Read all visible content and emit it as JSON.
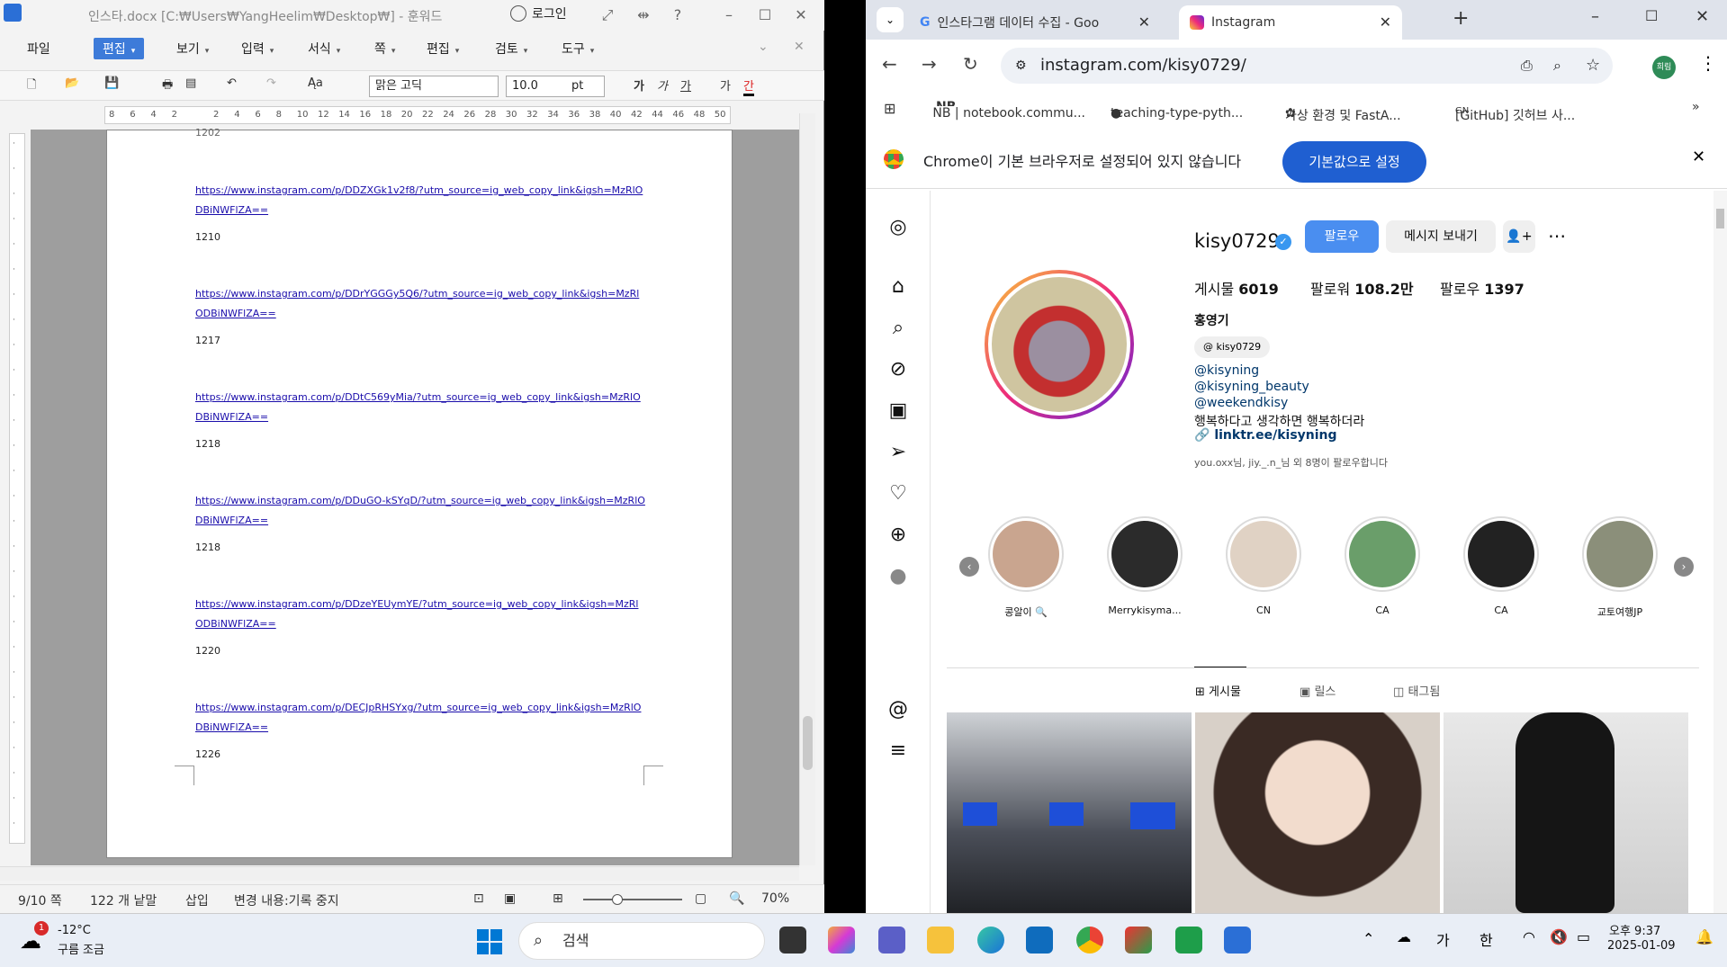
{
  "hwp": {
    "title": "인스타.docx [C:₩Users₩YangHeelim₩Desktop₩] - 훈워드",
    "login": "로그인",
    "menu": [
      "파일",
      "편집",
      "보기",
      "입력",
      "서식",
      "쪽",
      "편집",
      "검토",
      "도구"
    ],
    "font_name": "맑은 고딕",
    "font_size": "10.0",
    "font_unit": "pt",
    "ruler_ticks": [
      "8",
      "6",
      "4",
      "2",
      "",
      "2",
      "4",
      "6",
      "8",
      "10",
      "12",
      "14",
      "16",
      "18",
      "20",
      "22",
      "24",
      "26",
      "28",
      "30",
      "32",
      "34",
      "36",
      "38",
      "40",
      "42",
      "44",
      "46",
      "48",
      "50"
    ],
    "entries": [
      {
        "url": "https://www.instagram.com/p/DDZXGk1v2f8/?utm_source=ig_web_copy_link&igsh=MzRlODBiNWFlZA==",
        "num": "1210"
      },
      {
        "url": "https://www.instagram.com/p/DDrYGGGy5Q6/?utm_source=ig_web_copy_link&igsh=MzRlODBiNWFlZA==",
        "num": "1217"
      },
      {
        "url": "https://www.instagram.com/p/DDtC569yMia/?utm_source=ig_web_copy_link&igsh=MzRlODBiNWFlZA==",
        "num": "1218"
      },
      {
        "url": "https://www.instagram.com/p/DDuGO-kSYqD/?utm_source=ig_web_copy_link&igsh=MzRlODBiNWFlZA==",
        "num": "1218"
      },
      {
        "url": "https://www.instagram.com/p/DDzeYEUymYE/?utm_source=ig_web_copy_link&igsh=MzRlODBiNWFlZA==",
        "num": "1220"
      },
      {
        "url": "https://www.instagram.com/p/DECJpRHSYxg/?utm_source=ig_web_copy_link&igsh=MzRlODBiNWFlZA==",
        "num": "1226"
      }
    ],
    "top_cut_num": "1202",
    "status": {
      "page": "9/10 쪽",
      "words": "122 개 낱말",
      "mode": "삽입",
      "track": "변경 내용:기록 중지",
      "zoom": "70%"
    }
  },
  "chrome": {
    "tab1": "인스타그램 데이터 수집 - Goo",
    "tab2": "Instagram",
    "url": "instagram.com/kisy0729/",
    "bookmarks": [
      "NB | notebook.commu...",
      "teaching-type-pyth...",
      "가상 환경 및 FastA...",
      "[GitHub] 깃허브 사..."
    ],
    "profile_badge": "희림",
    "infobar_msg": "Chrome이 기본 브라우저로 설정되어 있지 않습니다",
    "infobar_btn": "기본값으로 설정"
  },
  "instagram": {
    "username": "kisy0729",
    "follow": "팔로우",
    "message": "메시지 보내기",
    "posts_label": "게시물",
    "posts": "6019",
    "followers_label": "팔로워",
    "followers": "108.2만",
    "following_label": "팔로우",
    "following": "1397",
    "name": "홍영기",
    "threads": "kisy0729",
    "bio1": "@kisyning",
    "bio2": "@kisyning_beauty",
    "bio3": "@weekendkisy",
    "bio4": "행복하다고 생각하면 행복하더라",
    "link": "linktr.ee/kisyning",
    "followed_by": "you.oxx님, jiy._.n_님 외 8명이 팔로우합니다",
    "highlights": [
      "콩알이 🔍",
      "Merrykisyma...",
      "CN",
      "CA",
      "CA",
      "교토여행JP"
    ],
    "tabs": [
      "게시물",
      "릴스",
      "태그됨"
    ]
  },
  "taskbar": {
    "weather_temp": "-12°C",
    "weather_desc": "구름 조금",
    "weather_badge": "1",
    "search": "검색",
    "ime1": "가",
    "ime2": "한",
    "time": "오후 9:37",
    "date": "2025-01-09"
  }
}
